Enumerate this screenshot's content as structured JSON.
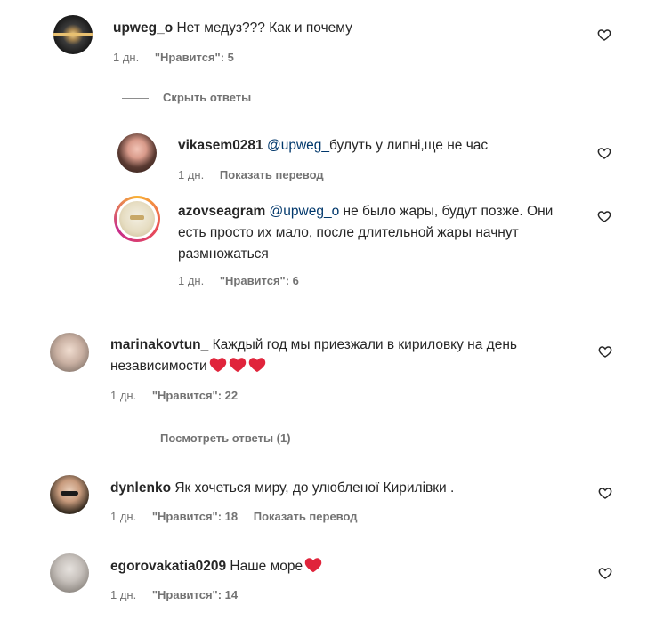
{
  "comments": {
    "c1": {
      "user": "upweg_o",
      "text": "Нет медуз??? Как и почему",
      "time": "1 дн.",
      "likes": "\"Нравится\": 5"
    },
    "hide_replies": "Скрыть ответы",
    "r1": {
      "user": "vikasem0281",
      "mention": "@upweg_",
      "text": "булуть у липні,ще не час",
      "time": "1 дн.",
      "translate": "Показать перевод"
    },
    "r2": {
      "user": "azovseagram",
      "mention": "@upweg_o",
      "text": " не было жары, будут позже. Они есть просто их мало, после длительной жары начнут размножаться",
      "time": "1 дн.",
      "likes": "\"Нравится\": 6"
    },
    "c2": {
      "user": "marinakovtun_",
      "text": " Каждый год мы приезжали в кириловку на день независимости",
      "time": "1 дн.",
      "likes": "\"Нравится\": 22"
    },
    "view_replies": "Посмотреть ответы (1)",
    "c3": {
      "user": "dynlenko",
      "text": " Як хочеться миру, до улюбленої Кирилівки .",
      "time": "1 дн.",
      "likes": "\"Нравится\": 18",
      "translate": "Показать перевод"
    },
    "c4": {
      "user": "egorovakatia0209",
      "text": " Наше море",
      "time": "1 дн.",
      "likes": "\"Нравится\": 14"
    }
  },
  "icons": {
    "like": "heart-outline-icon",
    "emoji_heart": "red-heart-emoji"
  },
  "colors": {
    "text": "#262626",
    "meta": "#737373",
    "mention": "#00376b",
    "heart": "#e0243b"
  }
}
